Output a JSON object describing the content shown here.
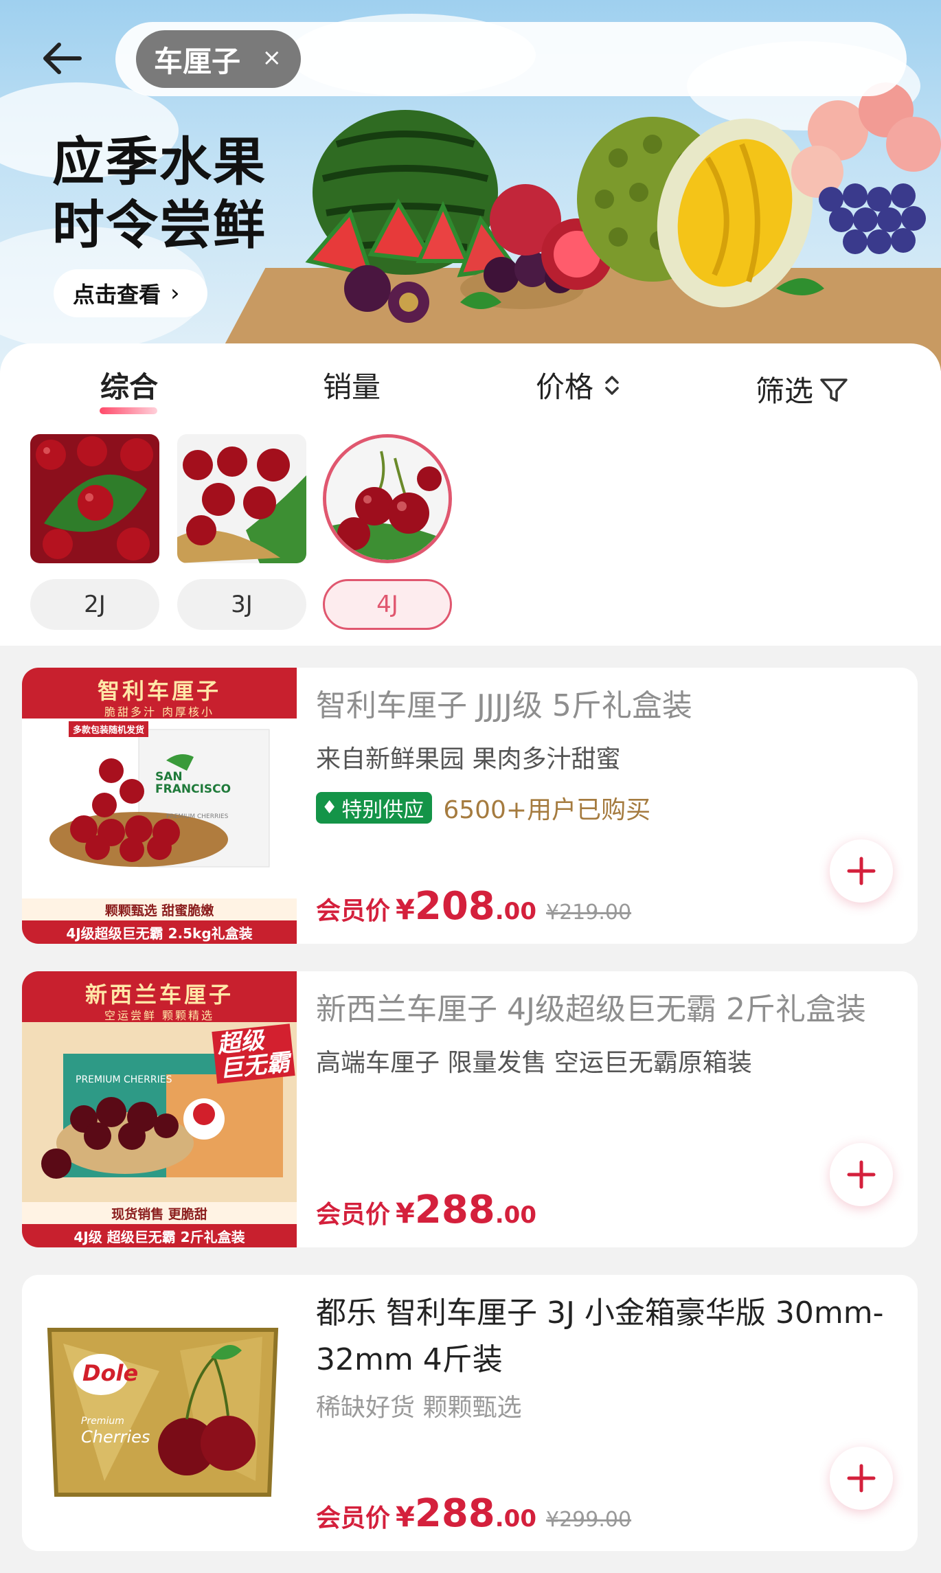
{
  "search": {
    "chip_text": "车厘子",
    "chip_close": "×"
  },
  "banner": {
    "line1": "应季水果",
    "line2": "时令尝鲜",
    "cta": "点击查看",
    "cta_chevron": "›"
  },
  "sort_tabs": [
    {
      "label": "综合",
      "active": true
    },
    {
      "label": "销量",
      "active": false
    },
    {
      "label": "价格",
      "active": false
    },
    {
      "label": "筛选",
      "active": false
    }
  ],
  "grades": [
    {
      "label": "2J",
      "selected": false
    },
    {
      "label": "3J",
      "selected": false
    },
    {
      "label": "4J",
      "selected": true
    }
  ],
  "products": [
    {
      "title": "智利车厘子 JJJJ级 5斤礼盒装",
      "subtitle": "来自新鲜果园 果肉多汁甜蜜",
      "badge": "特别供应",
      "buyers": "6500+用户已购买",
      "price_label": "会员价",
      "currency": "¥",
      "price_int": "208",
      "price_dec": ".00",
      "original_price": "¥219.00",
      "image": {
        "head": "智利车厘子",
        "head_sub": "脆甜多汁 肉厚核小",
        "tag": "多款包装随机发货",
        "brand_1": "SAN",
        "brand_2": "FRANCISCO",
        "brand_3": "PREMIUM CHERRIES",
        "foot_1": "颗颗甄选 甜蜜脆嫩",
        "foot_2": "4J级超级巨无霸 2.5kg礼盒装"
      }
    },
    {
      "title": "新西兰车厘子 4J级超级巨无霸 2斤礼盒装",
      "subtitle": "高端车厘子 限量发售 空运巨无霸原箱装",
      "price_label": "会员价",
      "currency": "¥",
      "price_int": "288",
      "price_dec": ".00",
      "image": {
        "head": "新西兰车厘子",
        "head_sub": "空运尝鲜 颗颗精选",
        "super_1": "超级",
        "super_2": "巨无霸",
        "brand": "PREMIUM CHERRIES",
        "foot_1": "现货销售 更脆甜",
        "foot_2": "4J级 超级巨无霸 2斤礼盒装"
      }
    },
    {
      "title": "都乐 智利车厘子 3J 小金箱豪华版 30mm-32mm 4斤装",
      "subtitle": "稀缺好货 颗颗甄选",
      "price_label": "会员价",
      "currency": "¥",
      "price_int": "288",
      "price_dec": ".00",
      "original_price": "¥299.00",
      "image": {
        "brand": "Dole",
        "caption_1": "Premium",
        "caption_2": "Cherries"
      }
    }
  ],
  "colors": {
    "accent": "#d4203c",
    "badge_green": "#149448",
    "selected_pink": "#e0576f",
    "buyers_gold": "#a57b3f"
  },
  "icons": [
    "back-arrow-icon",
    "close-icon",
    "sort-updown-icon",
    "filter-funnel-icon",
    "diamond-icon",
    "plus-icon"
  ]
}
